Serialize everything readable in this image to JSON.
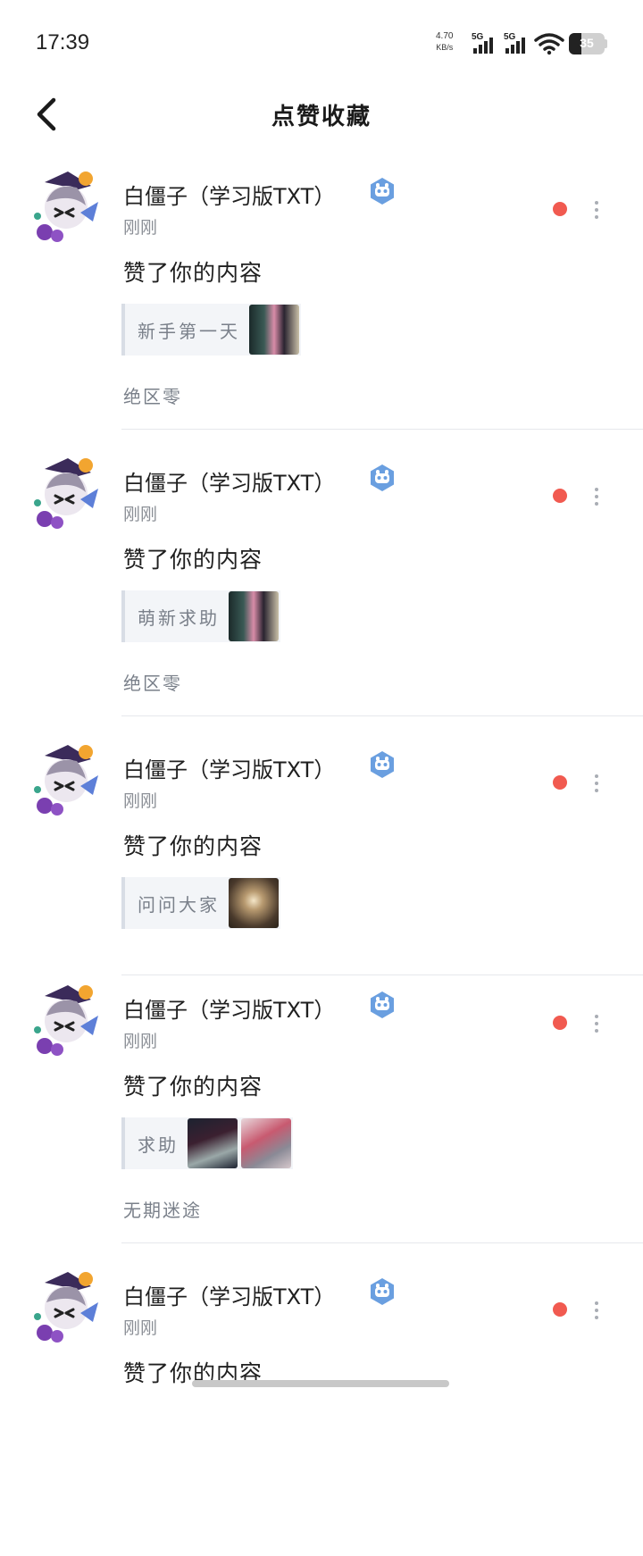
{
  "status_bar": {
    "time": "17:39",
    "net_speed_value": "4.70",
    "net_speed_unit": "KB/s",
    "signal1_label": "5G",
    "signal2_label": "5G",
    "battery_level": "35",
    "battery_fraction": 0.35
  },
  "header": {
    "back_icon": "chevron-left-icon",
    "title": "点赞收藏"
  },
  "colors": {
    "unread_dot": "#f15a50",
    "badge": "#6a9fe0",
    "divider": "#e6e8ec"
  },
  "notifications": [
    {
      "user_name": "白僵子（学习版TXT）",
      "time": "刚刚",
      "action": "赞了你的内容",
      "ref_title": "新手第一天",
      "thumb_count": 1,
      "game": "绝区零"
    },
    {
      "user_name": "白僵子（学习版TXT）",
      "time": "刚刚",
      "action": "赞了你的内容",
      "ref_title": "萌新求助",
      "thumb_count": 1,
      "game": "绝区零"
    },
    {
      "user_name": "白僵子（学习版TXT）",
      "time": "刚刚",
      "action": "赞了你的内容",
      "ref_title": "问问大家",
      "thumb_count": 1,
      "game": ""
    },
    {
      "user_name": "白僵子（学习版TXT）",
      "time": "刚刚",
      "action": "赞了你的内容",
      "ref_title": "求助",
      "thumb_count": 2,
      "game": "无期迷途"
    },
    {
      "user_name": "白僵子（学习版TXT）",
      "time": "刚刚",
      "action": "赞了你的内容"
    }
  ]
}
